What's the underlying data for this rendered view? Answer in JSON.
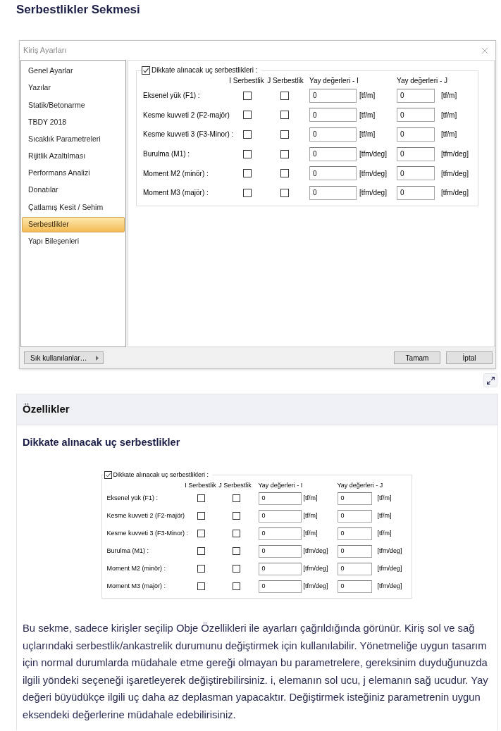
{
  "page_title": "Serbestlikler Sekmesi",
  "dialog": {
    "title": "Kiriş Ayarları",
    "sidebar": {
      "items": [
        {
          "label": "Genel Ayarlar",
          "selected": false
        },
        {
          "label": "Yazılar",
          "selected": false
        },
        {
          "label": "Statik/Betonarme",
          "selected": false
        },
        {
          "label": "TBDY 2018",
          "selected": false
        },
        {
          "label": "Sıcaklık Parametreleri",
          "selected": false
        },
        {
          "label": "Rijitlik Azaltılması",
          "selected": false
        },
        {
          "label": "Performans Analizi",
          "selected": false
        },
        {
          "label": "Donatılar",
          "selected": false
        },
        {
          "label": "Çatlamış Kesit / Sehim",
          "selected": false
        },
        {
          "label": "Serbestlikler",
          "selected": true
        },
        {
          "label": "Yapı Bileşenleri",
          "selected": false
        }
      ]
    },
    "releases": {
      "legend": "Dikkate alınacak uç serbestlikleri :",
      "checked": true,
      "columns": [
        "I Serbestlik",
        "J Serbestlik",
        "Yay değerleri - I",
        "Yay değerleri - J"
      ],
      "rows": [
        {
          "label": "Eksenel yük (F1) :",
          "i_free": false,
          "j_free": false,
          "spring_i": "0",
          "unit_i": "[tf/m]",
          "spring_j": "0",
          "unit_j": "[tf/m]"
        },
        {
          "label": "Kesme kuvveti 2 (F2-majör)",
          "i_free": false,
          "j_free": false,
          "spring_i": "0",
          "unit_i": "[tf/m]",
          "spring_j": "0",
          "unit_j": "[tf/m]"
        },
        {
          "label": "Kesme kuvveti 3 (F3-Minor) :",
          "i_free": false,
          "j_free": false,
          "spring_i": "0",
          "unit_i": "[tf/m]",
          "spring_j": "0",
          "unit_j": "[tf/m]"
        },
        {
          "label": "Burulma (M1) :",
          "i_free": false,
          "j_free": false,
          "spring_i": "0",
          "unit_i": "[tfm/deg]",
          "spring_j": "0",
          "unit_j": "[tfm/deg]"
        },
        {
          "label": "Moment M2 (minör) :",
          "i_free": false,
          "j_free": false,
          "spring_i": "0",
          "unit_i": "[tfm/deg]",
          "spring_j": "0",
          "unit_j": "[tfm/deg]"
        },
        {
          "label": "Moment M3 (majör) :",
          "i_free": false,
          "j_free": false,
          "spring_i": "0",
          "unit_i": "[tfm/deg]",
          "spring_j": "0",
          "unit_j": "[tfm/deg]"
        }
      ]
    },
    "favorites_button": "Sık kullanılanlar…",
    "buttons": [
      "Tamam",
      "İptal"
    ]
  },
  "properties": {
    "header": "Özellikler",
    "subtitle": "Dikkate alınacak uç serbestlikler",
    "figure": {
      "legend": "Dikkate alınacak uç serbestlikleri :",
      "checked": true,
      "columns": [
        "I Serbestlik",
        "J Serbestlik",
        "Yay değerleri - I",
        "Yay değerleri - J"
      ],
      "rows": [
        {
          "label": "Eksenel yük (F1) :",
          "i_free": false,
          "j_free": false,
          "spring_i": "0",
          "unit_i": "[tf/m]",
          "spring_j": "0",
          "unit_j": "[tf/m]"
        },
        {
          "label": "Kesme kuvveti 2 (F2-majör)",
          "i_free": false,
          "j_free": false,
          "spring_i": "0",
          "unit_i": "[tf/m]",
          "spring_j": "0",
          "unit_j": "[tf/m]"
        },
        {
          "label": "Kesme kuvveti 3 (F3-Minor) :",
          "i_free": false,
          "j_free": false,
          "spring_i": "0",
          "unit_i": "[tf/m]",
          "spring_j": "0",
          "unit_j": "[tf/m]"
        },
        {
          "label": "Burulma (M1) :",
          "i_free": false,
          "j_free": false,
          "spring_i": "0",
          "unit_i": "[tfm/deg]",
          "spring_j": "0",
          "unit_j": "[tfm/deg]"
        },
        {
          "label": "Moment M2 (minör) :",
          "i_free": false,
          "j_free": false,
          "spring_i": "0",
          "unit_i": "[tfm/deg]",
          "spring_j": "0",
          "unit_j": "[tfm/deg]"
        },
        {
          "label": "Moment M3 (majör) :",
          "i_free": false,
          "j_free": false,
          "spring_i": "0",
          "unit_i": "[tfm/deg]",
          "spring_j": "0",
          "unit_j": "[tfm/deg]"
        }
      ]
    },
    "paragraph": "Bu sekme, sadece kirişler seçilip Obje Özellikleri ile ayarları çağrıldığında görünür. Kiriş sol ve sağ uçlarındaki serbestlik/ankastrelik durumunu değiştirmek için kullanılabilir. Yönetmeliğe uygun tasarım için normal durumlarda müdahale etme gereği olmayan bu parametrelere, gereksinim duyduğunuzda ilgili yöndeki seçeneği işaretleyerek değiştirebilirsiniz. i, elemanın sol ucu, j elemanın sağ ucudur. Yay değeri büyüdükçe ilgili uç daha az deplasman yapacaktır. Değiştirmek isteğiniz parametrenin uygun eksendeki değerlerine müdahale edebilirisiniz."
  }
}
